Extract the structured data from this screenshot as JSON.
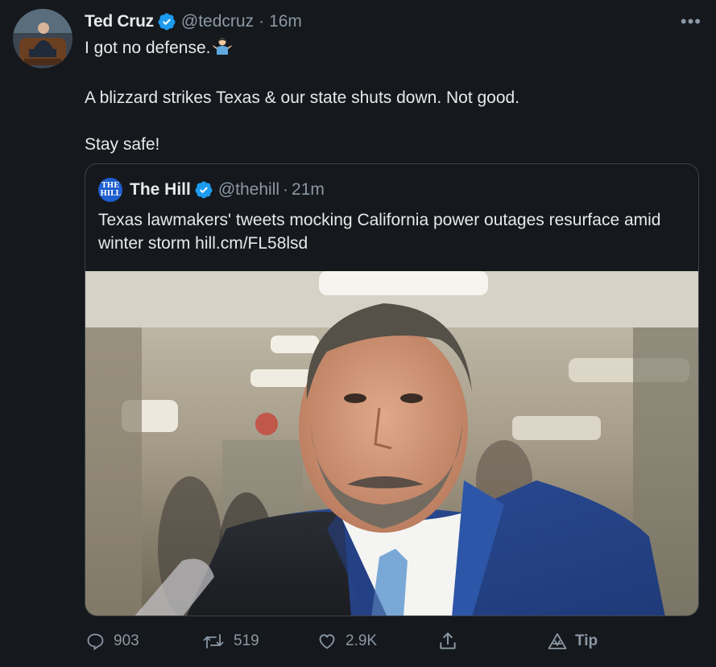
{
  "author": {
    "name": "Ted Cruz",
    "handle": "@tedcruz",
    "separator": "·",
    "time": "16m",
    "more_label": "•••"
  },
  "tweet": {
    "line1": "I got no defense.",
    "line1_emoji": "man-shrugging-emoji",
    "line2": "A blizzard strikes Texas & our state shuts down. Not good.",
    "line3": "Stay safe!"
  },
  "quoted": {
    "avatar_text": "THE HILL",
    "name": "The Hill",
    "handle": "@thehill",
    "separator": "·",
    "time": "21m",
    "text": "Texas lawmakers' tweets mocking California power outages resurface amid winter storm hill.cm/FL58lsd",
    "image": "photo-man-in-blue-suit-in-hallway"
  },
  "actions": {
    "reply_count": "903",
    "retweet_count": "519",
    "like_count": "2.9K",
    "tip_label": "Tip"
  },
  "colors": {
    "background": "#15181c",
    "text": "#e7e9ea",
    "secondary": "#8b98a5",
    "verified": "#1d9bf0",
    "border": "#3e4144"
  }
}
